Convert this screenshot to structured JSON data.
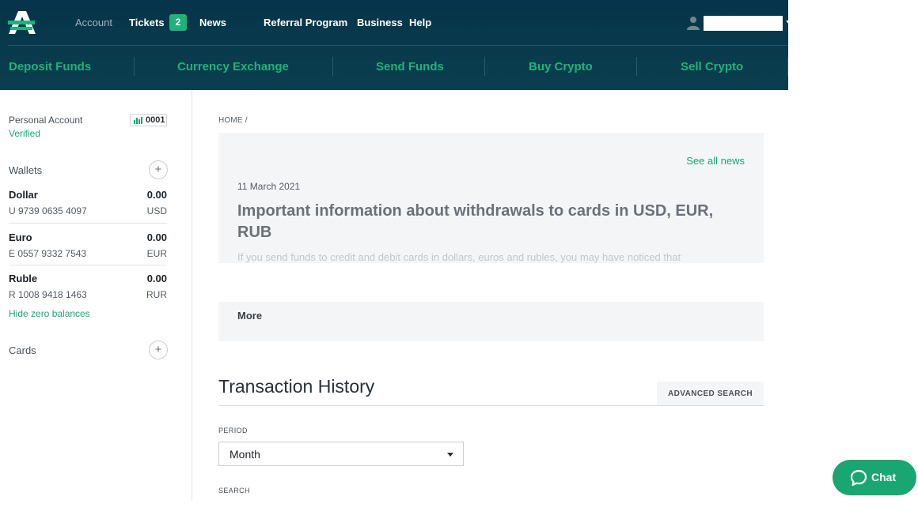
{
  "header": {
    "nav": {
      "account": "Account",
      "tickets": "Tickets",
      "tickets_count": "2",
      "news": "News",
      "referral": "Referral Program",
      "business": "Business",
      "help": "Help"
    },
    "actions": {
      "deposit": "Deposit Funds",
      "exchange": "Currency Exchange",
      "send": "Send Funds",
      "buy": "Buy Crypto",
      "sell": "Sell Crypto"
    }
  },
  "sidebar": {
    "account_label": "Personal Account",
    "account_status": "Verified",
    "account_code": "0001",
    "wallets_title": "Wallets",
    "wallets": [
      {
        "name": "Dollar",
        "amount": "0.00",
        "number": "U 9739 0635 4097",
        "currency": "USD"
      },
      {
        "name": "Euro",
        "amount": "0.00",
        "number": "E 0557 9332 7543",
        "currency": "EUR"
      },
      {
        "name": "Ruble",
        "amount": "0.00",
        "number": "R 1008 9418 1463",
        "currency": "RUR"
      }
    ],
    "hide_zero": "Hide zero balances",
    "cards_title": "Cards",
    "plus": "+"
  },
  "main": {
    "breadcrumb": "HOME /",
    "news": {
      "see_all": "See all news",
      "date": "11 March 2021",
      "title": "Important information about withdrawals to cards in USD, EUR, RUB",
      "excerpt": "If you send funds to credit and debit cards in dollars, euros and rubles, you may have noticed that"
    },
    "more": "More",
    "transactions": {
      "title": "Transaction History",
      "advanced_search": "ADVANCED SEARCH",
      "period_label": "PERIOD",
      "period_value": "Month",
      "search_label": "SEARCH"
    }
  },
  "chat": {
    "label": "Chat"
  },
  "colors": {
    "header_bg": "#06344a",
    "accent": "#1aa673",
    "badge": "#1db37a"
  }
}
